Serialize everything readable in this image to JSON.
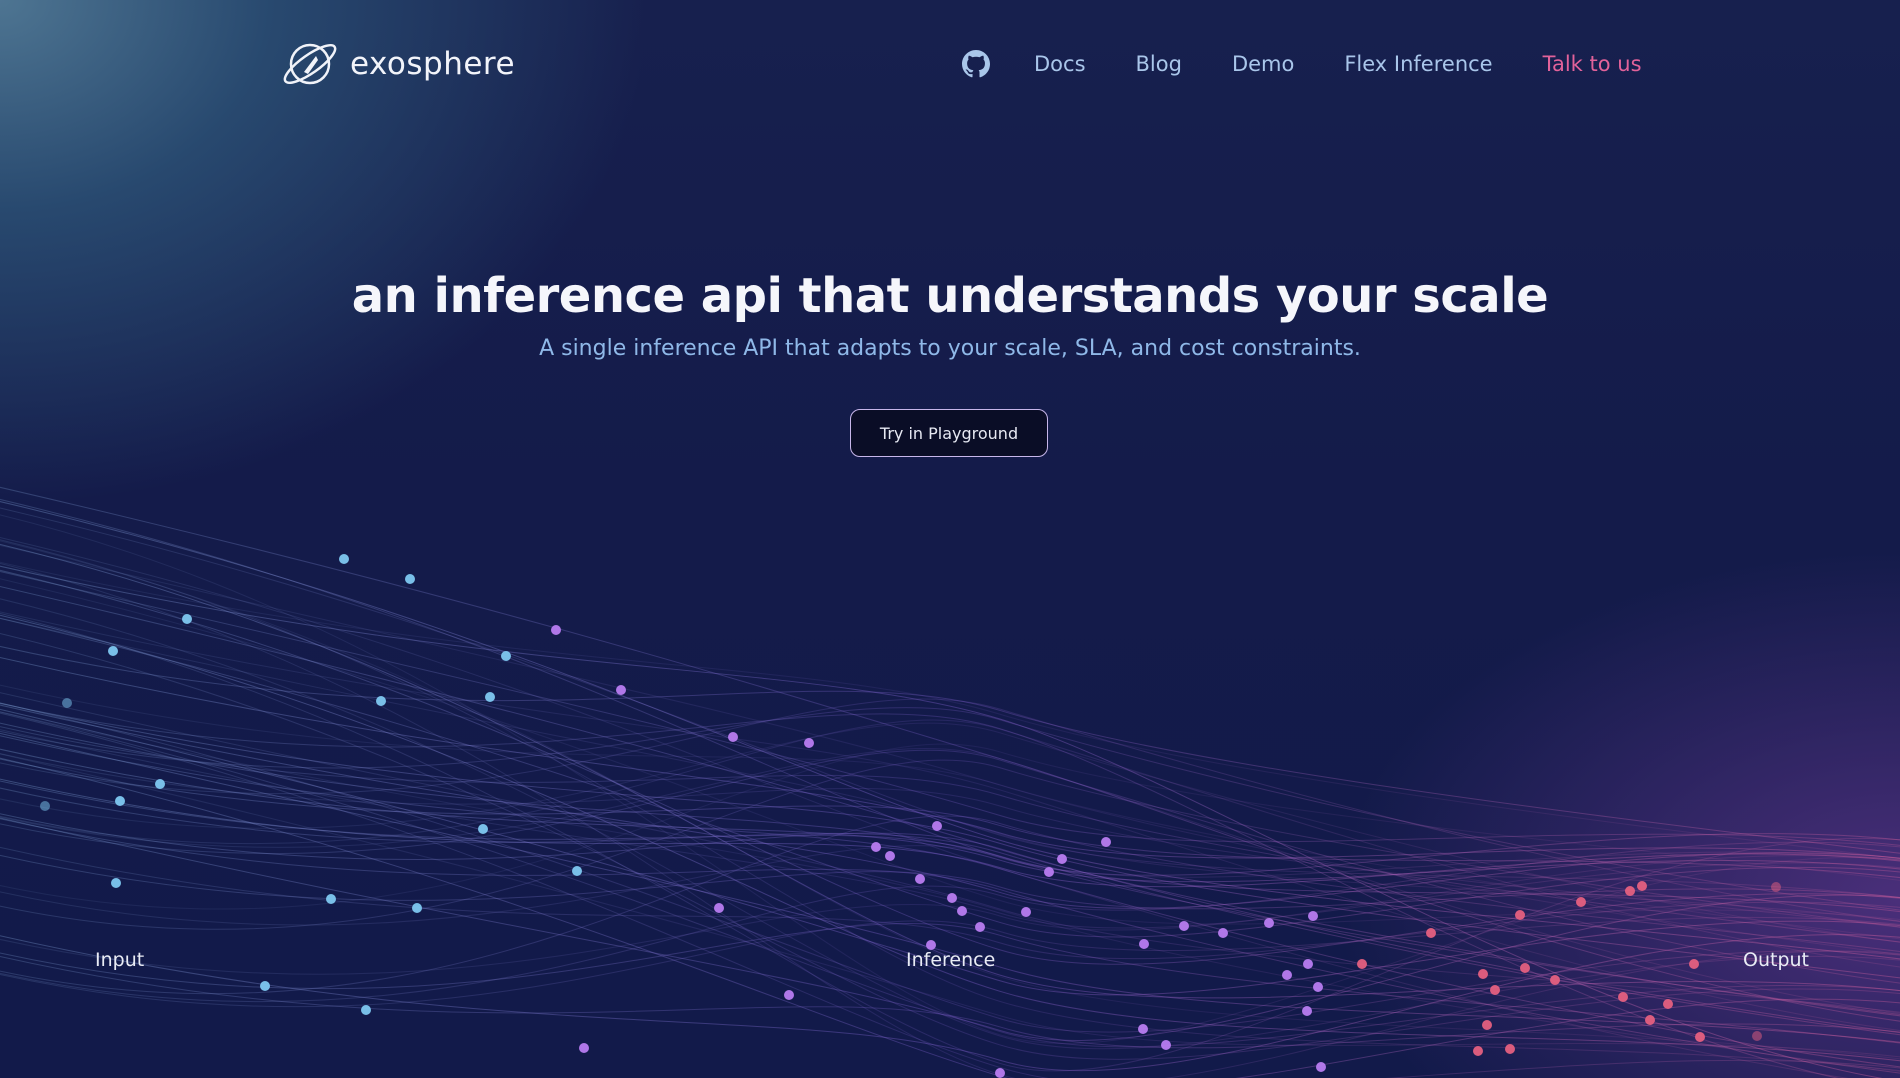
{
  "brand": {
    "name": "exosphere",
    "logo_icon": "planet-rocket-icon"
  },
  "nav": {
    "github_icon": "github-icon",
    "links": [
      "Docs",
      "Blog",
      "Demo",
      "Flex Inference"
    ],
    "cta": "Talk to us"
  },
  "hero": {
    "title": "an inference api that understands your scale",
    "subtitle": "A single inference API that adapts to your scale, SLA, and cost constraints.",
    "button": "Try in Playground"
  },
  "stages": {
    "input": "Input",
    "inference": "Inference",
    "output": "Output"
  },
  "colors": {
    "accent_pink": "#e2629a",
    "link_blue": "#a9c6ea",
    "subtitle_blue": "#8fb8e8",
    "dot_blue": "#7ec8f0",
    "dot_purple": "#b87cf0",
    "dot_pink": "#e5607f"
  }
}
